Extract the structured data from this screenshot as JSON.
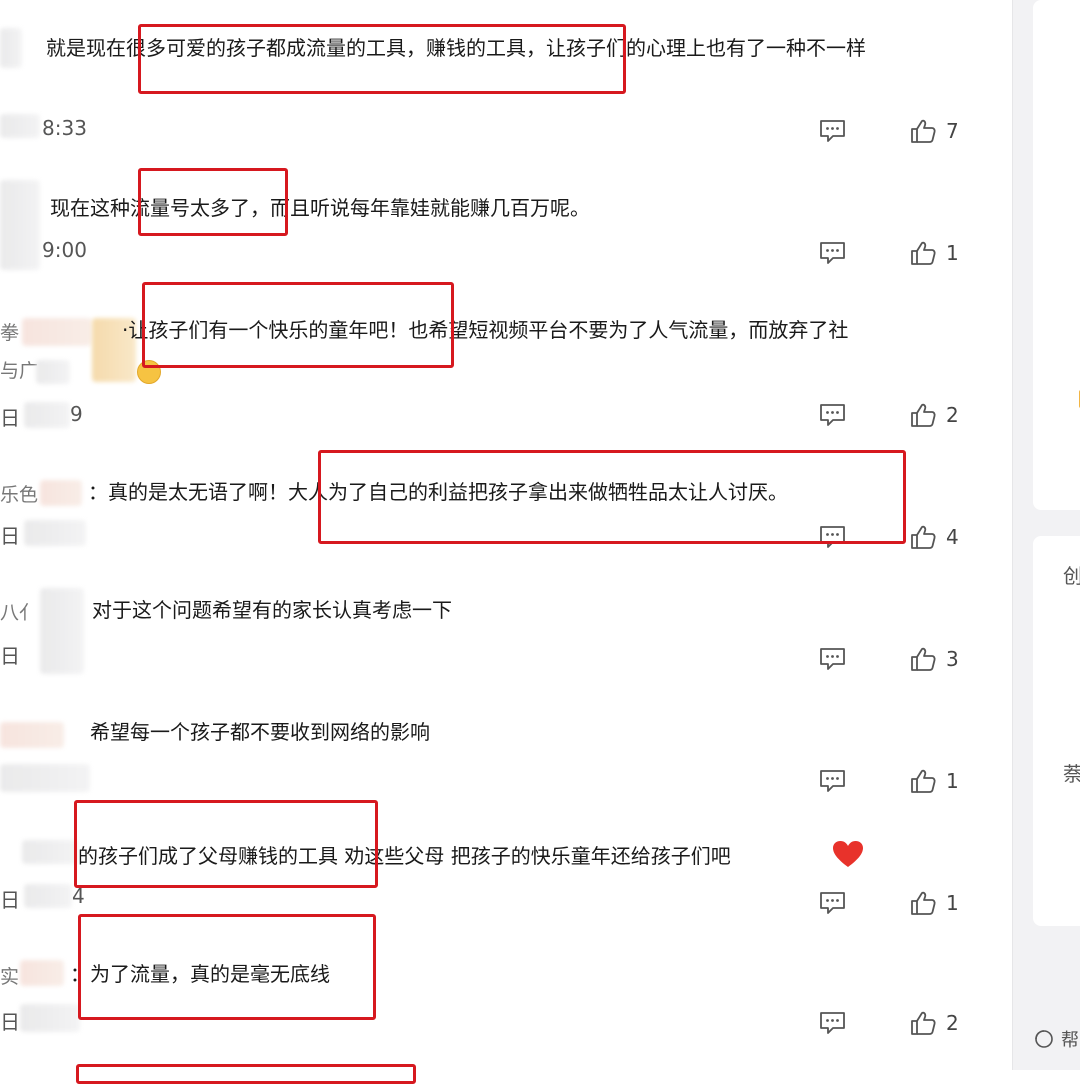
{
  "comments": [
    {
      "name": "",
      "text": "就是现在很多可爱的孩子都成流量的工具，赚钱的工具，让孩子们的心理上也有了一种不一样",
      "time": "8:33",
      "likes": "7"
    },
    {
      "name": "",
      "text": "现在这种流量号太多了，而且听说每年靠娃就能赚几百万呢。",
      "time": "9:00",
      "likes": "1"
    },
    {
      "name": "",
      "name_tail": "与广",
      "text": "·让孩子们有一个快乐的童年吧！也希望短视频平台不要为了人气流量，而放弃了社",
      "time": "日",
      "time_tail": "9",
      "likes": "2"
    },
    {
      "name": "乐色",
      "text": "：真的是太无语了啊！大人为了自己的利益把孩子拿出来做牺牲品太让人讨厌。",
      "time": "日",
      "likes": "4"
    },
    {
      "name": "八亻",
      "text": "对于这个问题希望有的家长认真考虑一下",
      "time": "日",
      "likes": "3"
    },
    {
      "name": "",
      "text": "希望每一个孩子都不要收到网络的影响",
      "time": "",
      "likes": "1"
    },
    {
      "name": "",
      "text": "的孩子们成了父母赚钱的工具 劝这些父母 把孩子的快乐童年还给孩子们吧",
      "time": "日",
      "time_tail": "4",
      "likes": "1"
    },
    {
      "name": "实",
      "text": "：为了流量，真的是毫无底线",
      "time": "日",
      "likes": "2"
    }
  ],
  "sidebar": {
    "glyphs": [
      "创",
      "萘",
      "帮"
    ]
  },
  "colors": {
    "highlight": "#d6181f",
    "heart": "#e8322b",
    "text": "#1a1a1a",
    "meta": "#555555"
  }
}
